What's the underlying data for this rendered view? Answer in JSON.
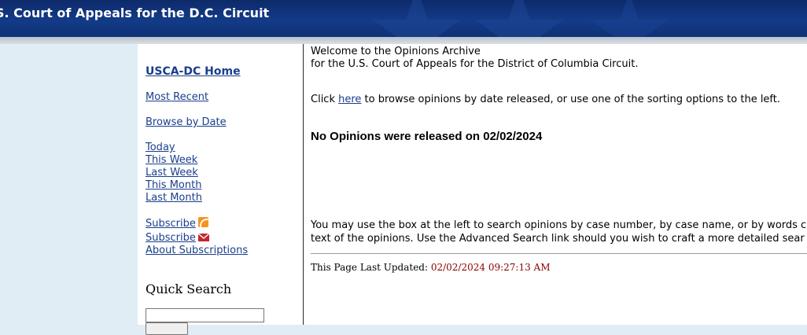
{
  "banner": {
    "title": "S. Court of Appeals for the D.C. Circuit"
  },
  "nav": {
    "home": "USCA-DC Home",
    "most_recent": "Most Recent",
    "browse_by_date": "Browse by Date",
    "today": "Today",
    "this_week": "This Week",
    "last_week": "Last Week",
    "this_month": "This Month",
    "last_month": "Last Month",
    "subscribe_rss": "Subscribe",
    "subscribe_email": "Subscribe",
    "about_subscriptions": "About Subscriptions",
    "rss_icon": "rss-feed-icon",
    "email_icon": "email-icon"
  },
  "quick_search": {
    "title": "Quick Search",
    "input_value": "",
    "button_label": ""
  },
  "main": {
    "welcome_line1": "Welcome to the Opinions Archive",
    "welcome_line2": "for the U.S. Court of Appeals for the District of Columbia Circuit.",
    "click_prefix": "Click ",
    "here_link": "here",
    "click_suffix": " to browse opinions by date released, or use one of the sorting options to the left.",
    "no_opinions": "No Opinions were released on 02/02/2024",
    "search_help_line1": "You may use the box at the left to search opinions by case number, by case name, or by words c",
    "search_help_line2": "text of the opinions. Use the Advanced Search link should you wish to craft a more detailed sear",
    "last_updated_label": "This Page Last Updated: ",
    "last_updated_value": "02/02/2024 09:27:13 AM"
  },
  "colors": {
    "banner": "#133b87",
    "link": "#1a3e8c",
    "timestamp": "#8b0000",
    "sidebar": "#e1edf5"
  }
}
